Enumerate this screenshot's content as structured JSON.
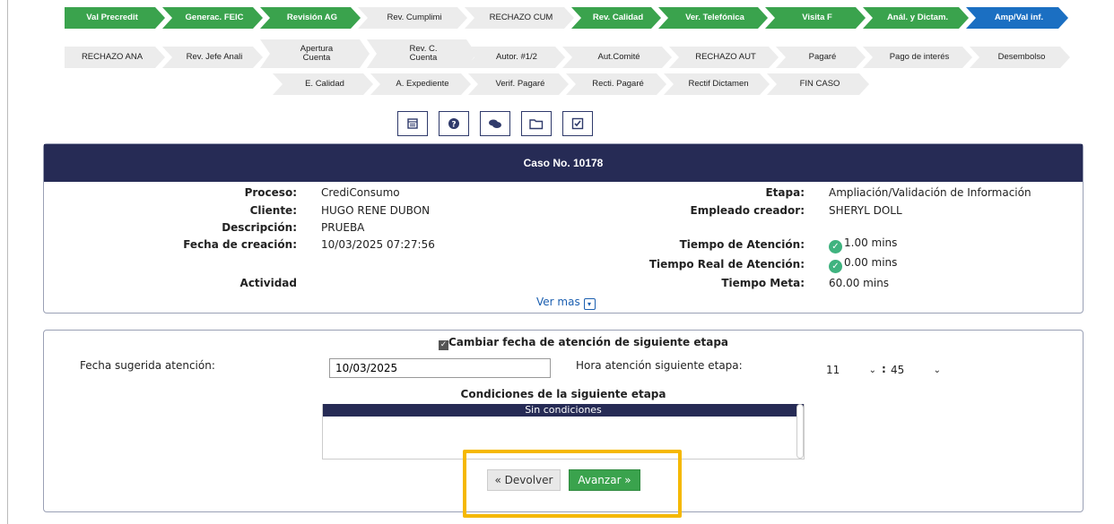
{
  "stages_row1": [
    {
      "label": "Val Precredit",
      "state": "green"
    },
    {
      "label": "Generac. FEIC",
      "state": "green"
    },
    {
      "label": "Revisión AG",
      "state": "green"
    },
    {
      "label": "Rev. Cumplimi",
      "state": "gray"
    },
    {
      "label": "RECHAZO CUM",
      "state": "gray"
    },
    {
      "label": "Rev. Calidad",
      "state": "green"
    },
    {
      "label": "Ver. Telefónica",
      "state": "green"
    },
    {
      "label": "Visita F",
      "state": "green"
    },
    {
      "label": "Anál. y Dictam.",
      "state": "green"
    },
    {
      "label": "Amp/Val inf.",
      "state": "blue"
    }
  ],
  "stages_row2": [
    {
      "label": "RECHAZO ANA"
    },
    {
      "label": "Rev. Jefe Anali"
    },
    {
      "label": "Apertura\nCuenta"
    },
    {
      "label": "Rev. C.\nCuenta"
    },
    {
      "label": "Autor. #1/2"
    },
    {
      "label": "Aut.Comité"
    },
    {
      "label": "RECHAZO AUT"
    },
    {
      "label": "Pagaré"
    },
    {
      "label": "Pago de interés"
    },
    {
      "label": "Desembolso"
    }
  ],
  "stages_row3": [
    {
      "label": "E. Calidad"
    },
    {
      "label": "A. Expediente"
    },
    {
      "label": "Verif. Pagaré"
    },
    {
      "label": "Recti. Pagaré"
    },
    {
      "label": "Rectif Dictamen"
    },
    {
      "label": "FIN CASO"
    }
  ],
  "toolbar_icons": [
    "calendar-icon",
    "question-icon",
    "comments-icon",
    "folder-icon",
    "checklist-icon"
  ],
  "case": {
    "title": "Caso No. 10178",
    "proceso_label": "Proceso:",
    "proceso": "CrediConsumo",
    "cliente_label": "Cliente:",
    "cliente": "HUGO RENE DUBON",
    "descripcion_label": "Descripción:",
    "descripcion": "PRUEBA",
    "fecha_label": "Fecha de creación:",
    "fecha": "10/03/2025 07:27:56",
    "actividad_label": "Actividad",
    "etapa_label": "Etapa:",
    "etapa": "Ampliación/Validación de Información",
    "empleado_label": "Empleado creador:",
    "empleado": "SHERYL DOLL",
    "tiempo_atencion_label": "Tiempo de Atención:",
    "tiempo_atencion": "1.00 mins",
    "tiempo_real_label": "Tiempo Real de Atención:",
    "tiempo_real": "0.00 mins",
    "tiempo_meta_label": "Tiempo Meta:",
    "tiempo_meta": "60.00 mins",
    "ver_mas": "Ver mas"
  },
  "form": {
    "cambiar_fecha_label": "Cambiar fecha de atención de siguiente etapa",
    "fecha_sugerida_label": "Fecha sugerida atención:",
    "fecha_sugerida_value": "10/03/2025",
    "hora_label": "Hora atención siguiente etapa:",
    "hour_value": "11",
    "minute_value": "45",
    "time_separator": ":",
    "condiciones_title": "Condiciones de la siguiente etapa",
    "condiciones_header": "Sin condiciones",
    "devolver_label": "« Devolver",
    "avanzar_label": "Avanzar »"
  },
  "colors": {
    "green": "#3aa34d",
    "blue": "#1b6fc2",
    "navy": "#262b55",
    "highlight": "#f5b800"
  }
}
